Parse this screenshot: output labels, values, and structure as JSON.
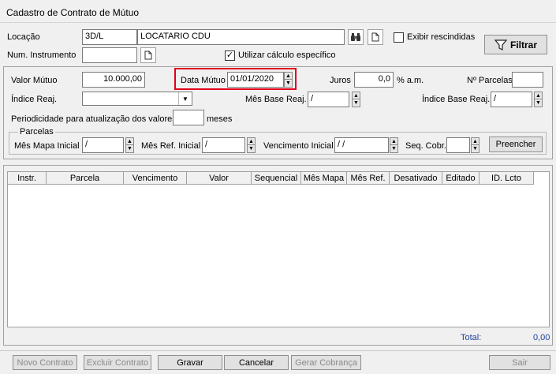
{
  "window": {
    "title": "Cadastro de Contrato de Mútuo"
  },
  "header": {
    "locacao_label": "Locação",
    "locacao_code": "3D/L",
    "locacao_name": "LOCATARIO CDU",
    "num_instrumento_label": "Num. Instrumento",
    "num_instrumento_value": "",
    "exibir_rescindidas_label": "Exibir rescindidas",
    "exibir_rescindidas_checked": false,
    "utilizar_calculo_label": "Utilizar cálculo específico",
    "utilizar_calculo_checked": true,
    "filtrar_label": "Filtrar"
  },
  "form": {
    "valor_mutuo_label": "Valor Mútuo",
    "valor_mutuo_value": "10.000,00",
    "data_mutuo_label": "Data Mútuo",
    "data_mutuo_value": "01/01/2020",
    "juros_label": "Juros",
    "juros_value": "0,0",
    "juros_unit": "% a.m.",
    "nparcelas_label": "Nº Parcelas",
    "nparcelas_value": "",
    "indice_reaj_label": "Índice Reaj.",
    "indice_reaj_value": "",
    "mes_base_reaj_label": "Mês Base Reaj.",
    "mes_base_reaj_value": "/",
    "indice_base_reaj_label": "Índice Base Reaj.",
    "indice_base_reaj_value": "/",
    "periodicidade_label": "Periodicidade para atualização dos valores",
    "periodicidade_value": "",
    "periodicidade_unit": "meses"
  },
  "parcelas": {
    "group_label": "Parcelas",
    "mes_mapa_inicial_label": "Mês Mapa Inicial",
    "mes_mapa_inicial_value": "/",
    "mes_ref_inicial_label": "Mês Ref. Inicial",
    "mes_ref_inicial_value": "/",
    "vencimento_inicial_label": "Vencimento Inicial",
    "vencimento_inicial_value": "/ /",
    "seq_cobr_label": "Seq. Cobr.",
    "seq_cobr_value": "",
    "preencher_label": "Preencher"
  },
  "grid": {
    "columns": [
      "Instr.",
      "Parcela",
      "Vencimento",
      "Valor",
      "Sequencial",
      "Mês Mapa",
      "Mês Ref.",
      "Desativado",
      "Editado",
      "ID. Lcto"
    ],
    "rows": [],
    "total_label": "Total:",
    "total_value": "0,00"
  },
  "footer": {
    "novo_contrato": "Novo Contrato",
    "excluir_contrato": "Excluir Contrato",
    "gravar": "Gravar",
    "cancelar": "Cancelar",
    "gerar_cobranca": "Gerar Cobrança",
    "sair": "Sair"
  },
  "colors": {
    "highlight_box": "#e0001a",
    "total_text": "#1f3fa0"
  }
}
